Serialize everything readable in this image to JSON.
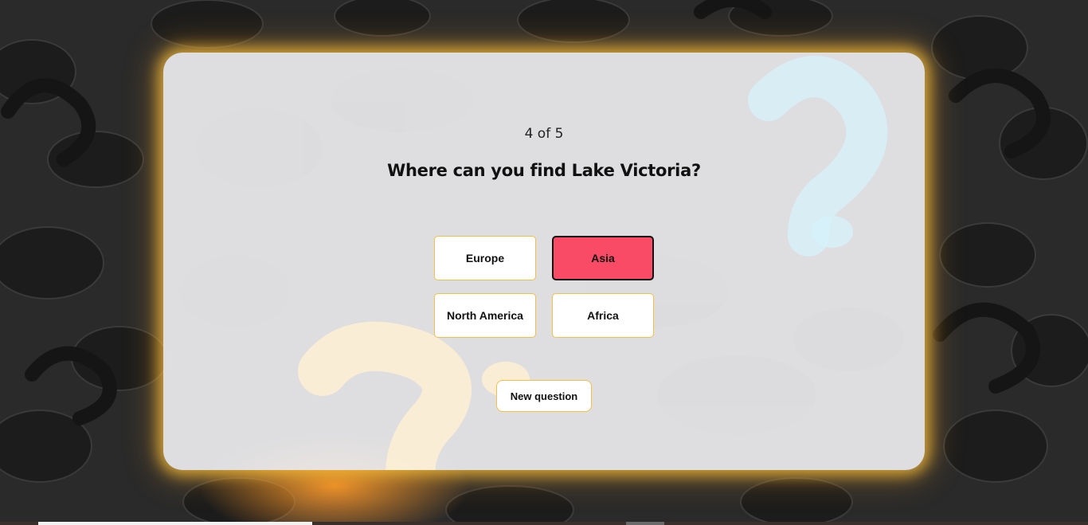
{
  "quiz": {
    "counter": "4 of 5",
    "question": "Where can you find Lake Victoria?",
    "answers": [
      {
        "label": "Europe",
        "state": "default"
      },
      {
        "label": "Asia",
        "state": "wrong"
      },
      {
        "label": "North America",
        "state": "default"
      },
      {
        "label": "Africa",
        "state": "default"
      }
    ],
    "new_question_label": "New question"
  },
  "colors": {
    "accent_border": "#f0c04a",
    "wrong_answer": "#fa4b66",
    "glow": "#ffc43c",
    "card": "#ececee"
  }
}
